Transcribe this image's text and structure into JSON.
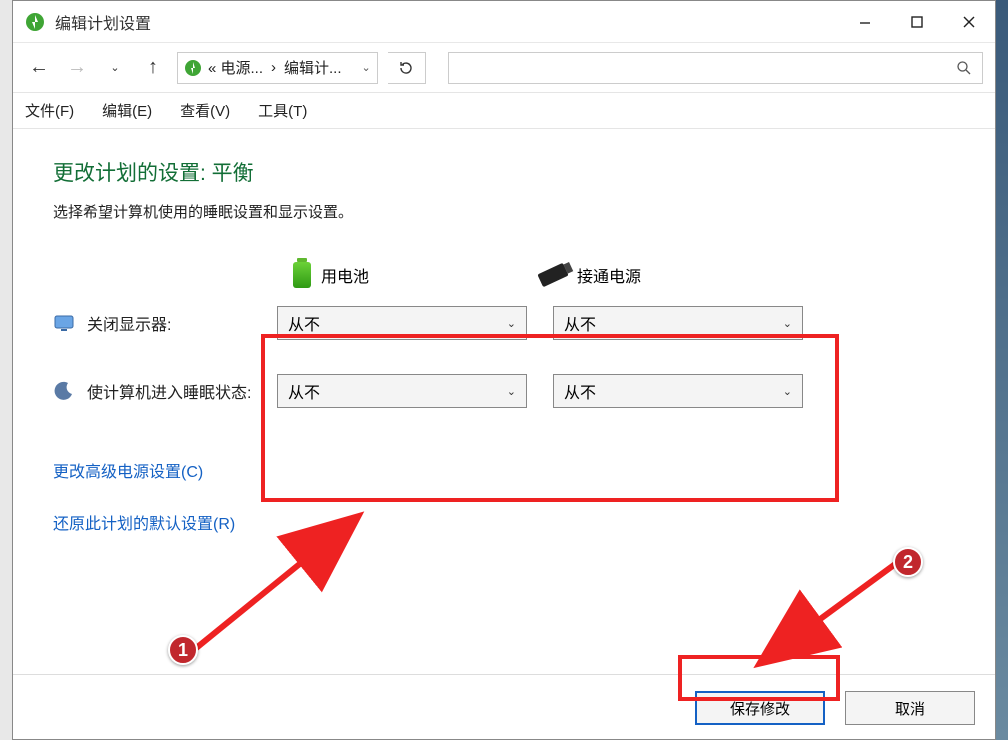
{
  "window": {
    "title": "编辑计划设置"
  },
  "breadcrumb": {
    "seg1": "« 电源...",
    "sep": "›",
    "seg2": "编辑计..."
  },
  "menu": {
    "file": "文件(F)",
    "edit": "编辑(E)",
    "view": "查看(V)",
    "tools": "工具(T)"
  },
  "plan": {
    "title": "更改计划的设置: 平衡",
    "desc": "选择希望计算机使用的睡眠设置和显示设置。"
  },
  "columns": {
    "battery": "用电池",
    "plugged": "接通电源"
  },
  "rows": {
    "display": {
      "label": "关闭显示器:",
      "battery": "从不",
      "plugged": "从不"
    },
    "sleep": {
      "label": "使计算机进入睡眠状态:",
      "battery": "从不",
      "plugged": "从不"
    }
  },
  "links": {
    "advanced": "更改高级电源设置(C)",
    "restore": "还原此计划的默认设置(R)"
  },
  "buttons": {
    "save": "保存修改",
    "cancel": "取消"
  },
  "markers": {
    "one": "1",
    "two": "2"
  }
}
